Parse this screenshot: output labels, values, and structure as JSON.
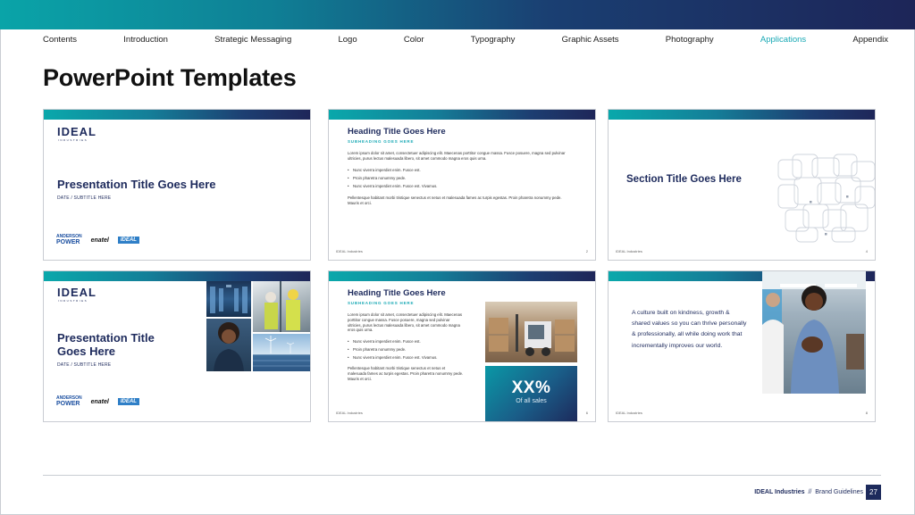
{
  "nav": {
    "items": [
      "Contents",
      "Introduction",
      "Strategic Messaging",
      "Logo",
      "Color",
      "Typography",
      "Graphic Assets",
      "Photography",
      "Applications",
      "Appendix"
    ],
    "active_index": 8,
    "active_color": "#19a9b5"
  },
  "page_title": "PowerPoint Templates",
  "slides": {
    "s1": {
      "logo": "IDEAL",
      "logo_sub": "INDUSTRIES",
      "title": "Presentation Title Goes Here",
      "subtitle": "DATE / SUBTITLE HERE",
      "brands": {
        "anderson_top": "ANDERSON",
        "anderson_bottom": "POWER",
        "enatel": "enatel",
        "ideal_tag": "IDEAL"
      }
    },
    "s2": {
      "heading": "Heading Title Goes Here",
      "subheading": "SUBHEADING GOES HERE",
      "para1": "Lorem ipsum dolor sit amet, consectetuer adipiscing elit. Maecenas porttitor congue massa. Fusce posuere, magna sed pulvinar ultricies, purus lectus malesuada libero, sit amet commodo magna eros quis urna.",
      "bullets": [
        "Nunc viverra imperdiet enim. Fusce est.",
        "Proin pharetra nonummy pede.",
        "Nunc viverra imperdiet enim. Fusce est. Vivamus."
      ],
      "para2": "Pellentesque habitant morbi tristique senectus et netus et malesuada fames ac turpis egestas. Proin pharetra nonummy pede. Mauris et orci.",
      "footer_left": "IDEAL Industries",
      "footer_num": "2"
    },
    "s3": {
      "title": "Section Title Goes Here",
      "footer_left": "IDEAL Industries",
      "footer_num": "4"
    },
    "s4": {
      "logo": "IDEAL",
      "logo_sub": "INDUSTRIES",
      "title": "Presentation Title Goes Here",
      "subtitle": "DATE / SUBTITLE HERE",
      "brands": {
        "anderson_top": "ANDERSON",
        "anderson_bottom": "POWER",
        "enatel": "enatel",
        "ideal_tag": "IDEAL"
      }
    },
    "s5": {
      "heading": "Heading Title Goes Here",
      "subheading": "SUBHEADING GOES HERE",
      "para1": "Lorem ipsum dolor sit amet, consectetuer adipiscing elit. Maecenas porttitor congue massa. Fusce posuere, magna sed pulvinar ultricies, purus lectus malesuada libero, sit amet commodo magna eros quis urna.",
      "bullets": [
        "Nunc viverra imperdiet enim. Fusce est.",
        "Proin pharetra nonummy pede.",
        "Nunc viverra imperdiet enim. Fusce est. Vivamus."
      ],
      "para2": "Pellentesque habitant morbi tristique senectus et netus et malesuada fames ac turpis egestas. Proin pharetra nonummy pede. Mauris et orci.",
      "stat_value": "XX%",
      "stat_label": "Of all sales",
      "footer_left": "IDEAL Industries",
      "footer_num": "6"
    },
    "s6": {
      "quote": "A culture built on kindness, growth & shared values so you can thrive personally & professionally, all while doing work that incrementally improves our world.",
      "footer_left": "IDEAL Industries",
      "footer_num": "8"
    }
  },
  "footer": {
    "brand": "IDEAL Industries",
    "separator": "//",
    "section": "Brand Guidelines",
    "page_number": "27"
  },
  "colors": {
    "navy": "#1d2a5c",
    "teal": "#19a9b5"
  }
}
